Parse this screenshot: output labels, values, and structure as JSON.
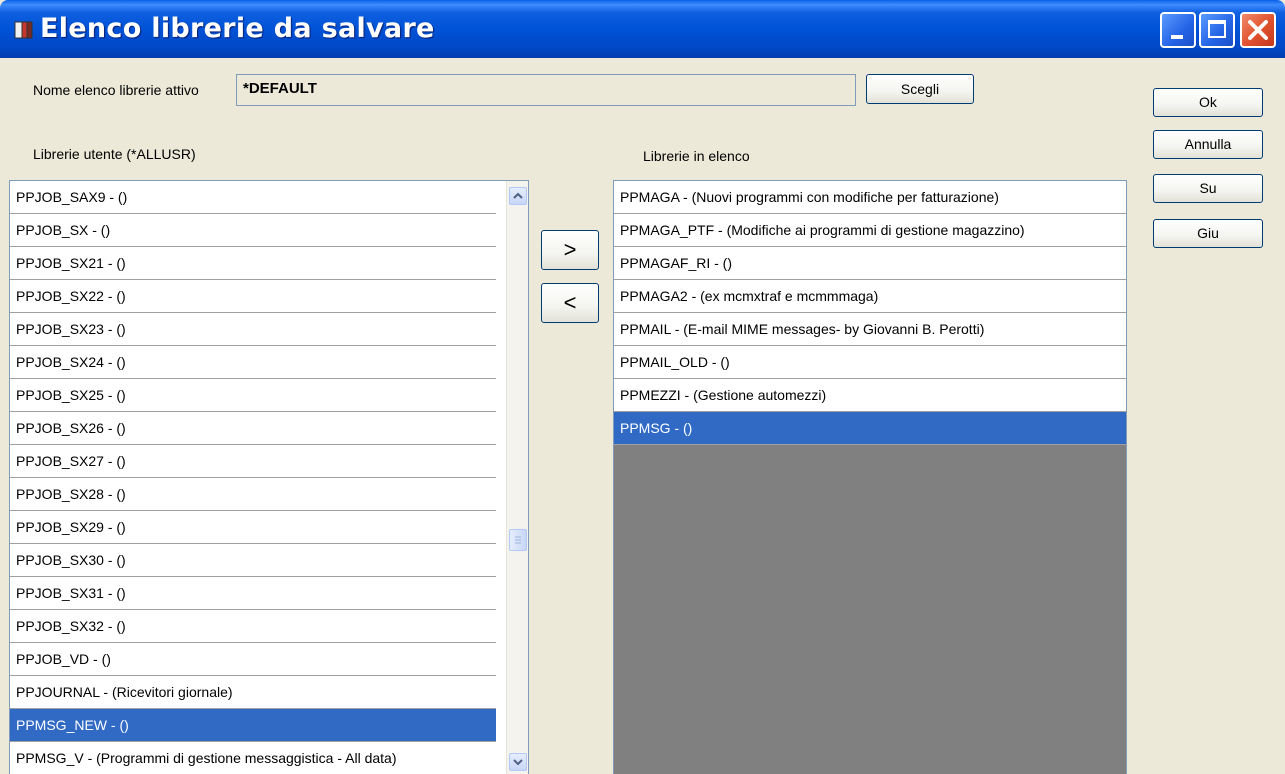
{
  "window": {
    "title": "Elenco librerie da salvare",
    "accent_color": "#0052D6",
    "selection_color": "#316AC5"
  },
  "active_list": {
    "label": "Nome elenco librerie attivo",
    "value": "*DEFAULT",
    "choose_button": "Scegli"
  },
  "left": {
    "label": "Librerie utente (*ALLUSR)",
    "items": [
      "PPJOB_SAX9 - ()",
      "PPJOB_SX - ()",
      "PPJOB_SX21 - ()",
      "PPJOB_SX22 - ()",
      "PPJOB_SX23 - ()",
      "PPJOB_SX24 - ()",
      "PPJOB_SX25 - ()",
      "PPJOB_SX26 - ()",
      "PPJOB_SX27 - ()",
      "PPJOB_SX28 - ()",
      "PPJOB_SX29 - ()",
      "PPJOB_SX30 - ()",
      "PPJOB_SX31 - ()",
      "PPJOB_SX32 - ()",
      "PPJOB_VD - ()",
      "PPJOURNAL - (Ricevitori giornale)",
      "PPMSG_NEW - ()",
      "PPMSG_V - (Programmi di gestione messaggistica - All data)"
    ],
    "selected_index": 16
  },
  "transfer": {
    "add": ">",
    "remove": "<"
  },
  "right": {
    "label": "Librerie in elenco",
    "items": [
      "PPMAGA - (Nuovi programmi con modifiche per fatturazione)",
      "PPMAGA_PTF - (Modifiche ai programmi di gestione magazzino)",
      "PPMAGAF_RI - ()",
      "PPMAGA2 - (ex mcmxtraf e mcmmmaga)",
      "PPMAIL - (E-mail MIME messages- by Giovanni B. Perotti)",
      "PPMAIL_OLD - ()",
      "PPMEZZI - (Gestione automezzi)",
      "PPMSG - ()"
    ],
    "selected_index": 7
  },
  "buttons": {
    "ok": "Ok",
    "cancel": "Annulla",
    "up": "Su",
    "down": "Giu"
  },
  "icons": {
    "app": "app-icon",
    "minimize": "minimize-icon",
    "maximize": "maximize-icon",
    "close": "close-icon",
    "scroll_up": "chevron-up-icon",
    "scroll_down": "chevron-down-icon"
  }
}
